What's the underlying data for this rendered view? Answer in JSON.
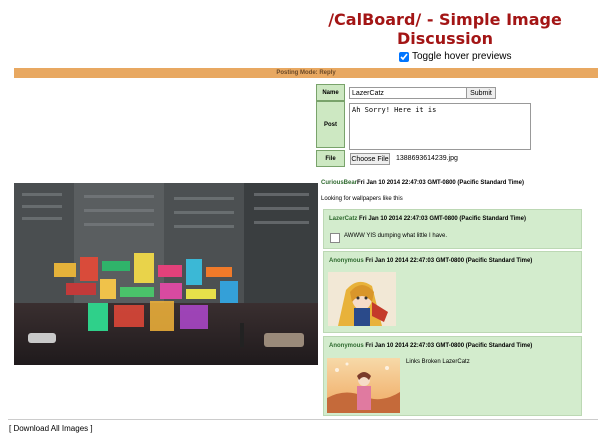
{
  "header": {
    "title": "/CalBoard/ - Simple Image Discussion"
  },
  "toggle": {
    "label": "Toggle hover previews",
    "checked": true
  },
  "posting_bar": {
    "label": "Posting Mode: Reply"
  },
  "form": {
    "name_label": "Name",
    "name_value": "LazerCatz",
    "submit_label": "Submit",
    "post_label": "Post",
    "post_value": "Ah Sorry! Here it is",
    "file_label": "File",
    "choose_file_label": "Choose File",
    "file_name": "1388693614239.jpg"
  },
  "thread": {
    "op": {
      "name": "CuriousBear",
      "date": "Fri Jan 10 2014 22:47:03 GMT-0800 (Pacific Standard Time)",
      "text": "Looking for wallpapers like this"
    },
    "replies": [
      {
        "name": "LazerCatz",
        "date": "Fri Jan 10 2014 22:47:03 GMT-0800 (Pacific Standard Time)",
        "text": "AWWW YIS dumping what little I have."
      },
      {
        "name": "Anonymous",
        "date": "Fri Jan 10 2014 22:47:03 GMT-0800 (Pacific Standard Time)",
        "text": ""
      },
      {
        "name": "Anonymous",
        "date": "Fri Jan 10 2014 22:47:03 GMT-0800 (Pacific Standard Time)",
        "text": "Links Broken LazerCatz"
      }
    ]
  },
  "footer": {
    "download_label": "[ Download All Images ]"
  },
  "colors": {
    "title": "#a31515",
    "posting_bar": "#e8a861",
    "reply_bg": "#d3eccd",
    "name_green": "#2f6a2f"
  }
}
